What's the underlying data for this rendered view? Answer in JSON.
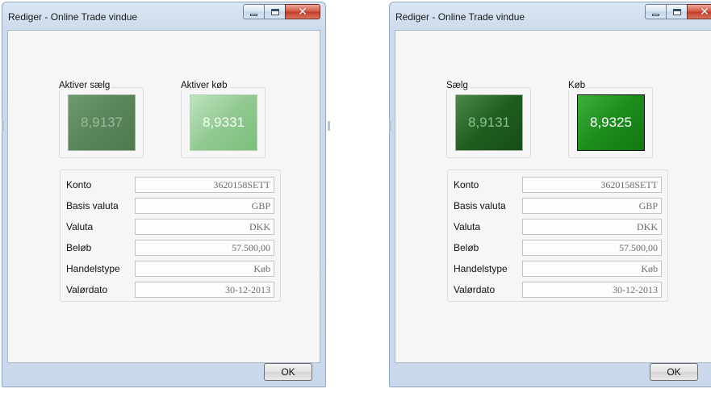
{
  "windows": [
    {
      "title": "Rediger - Online Trade vindue",
      "sell_label": "Aktiver sælg",
      "sell_value": "8,9137",
      "buy_label": "Aktiver køb",
      "buy_value": "8,9331",
      "fields": [
        {
          "label": "Konto",
          "value": "3620158SETT"
        },
        {
          "label": "Basis valuta",
          "value": "GBP"
        },
        {
          "label": "Valuta",
          "value": "DKK"
        },
        {
          "label": "Beløb",
          "value": "57.500,00"
        },
        {
          "label": "Handelstype",
          "value": "Køb"
        },
        {
          "label": "Valørdato",
          "value": "30-12-2013"
        }
      ],
      "ok_label": "OK"
    },
    {
      "title": "Rediger - Online Trade vindue",
      "sell_label": "Sælg",
      "sell_value": "8,9131",
      "buy_label": "Køb",
      "buy_value": "8,9325",
      "fields": [
        {
          "label": "Konto",
          "value": "3620158SETT"
        },
        {
          "label": "Basis valuta",
          "value": "GBP"
        },
        {
          "label": "Valuta",
          "value": "DKK"
        },
        {
          "label": "Beløb",
          "value": "57.500,00"
        },
        {
          "label": "Handelstype",
          "value": "Køb"
        },
        {
          "label": "Valørdato",
          "value": "30-12-2013"
        }
      ],
      "ok_label": "OK"
    }
  ],
  "colors": {
    "sell_tile_left": "#5b865b",
    "buy_tile_left": "#92c992",
    "sell_tile_right": "#1f5e1f",
    "buy_tile_right": "#1c8c1c",
    "close_button": "#c13b26"
  }
}
